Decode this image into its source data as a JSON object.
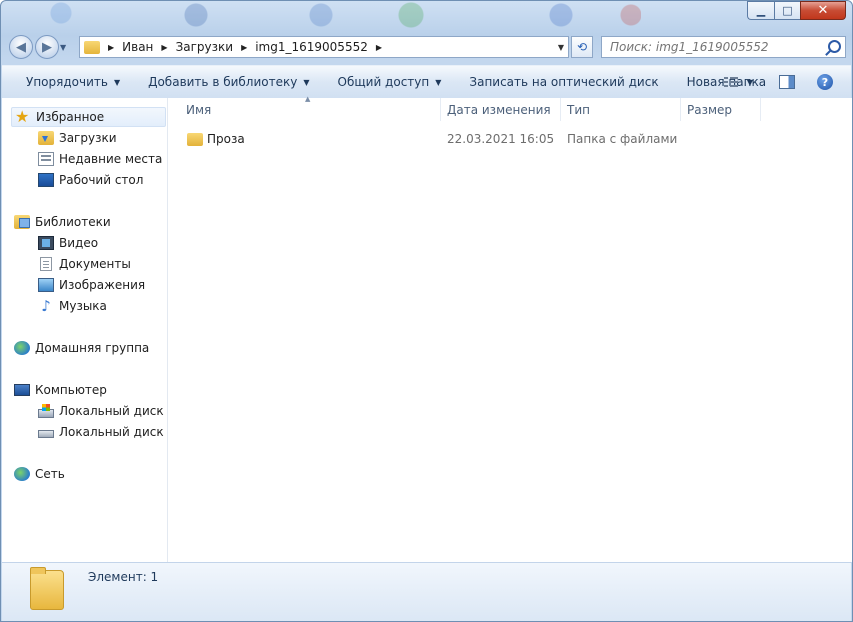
{
  "window": {
    "minimize": "▁",
    "maximize": "□",
    "close": "✕"
  },
  "nav": {
    "back": "◀",
    "forward": "▶",
    "breadcrumb": [
      "Иван",
      "Загрузки",
      "img1_1619005552"
    ],
    "search_placeholder": "Поиск: img1_1619005552"
  },
  "toolbar": {
    "organize": "Упорядочить",
    "add_to_library": "Добавить в библиотеку",
    "share": "Общий доступ",
    "burn": "Записать на оптический диск",
    "new_folder": "Новая папка",
    "help": "?"
  },
  "sidebar": {
    "favorites": "Избранное",
    "downloads": "Загрузки",
    "recent_places": "Недавние места",
    "desktop": "Рабочий стол",
    "libraries": "Библиотеки",
    "video": "Видео",
    "documents": "Документы",
    "images": "Изображения",
    "music": "Музыка",
    "homegroup": "Домашняя группа",
    "computer": "Компьютер",
    "local_disk_c": "Локальный диск (C",
    "local_disk_d": "Локальный диск (D",
    "network": "Сеть"
  },
  "columns": {
    "name": "Имя",
    "date": "Дата изменения",
    "type": "Тип",
    "size": "Размер"
  },
  "files": [
    {
      "name": "Проза",
      "date": "22.03.2021 16:05",
      "type": "Папка с файлами",
      "size": ""
    }
  ],
  "details": {
    "items_count": "Элемент: 1"
  }
}
